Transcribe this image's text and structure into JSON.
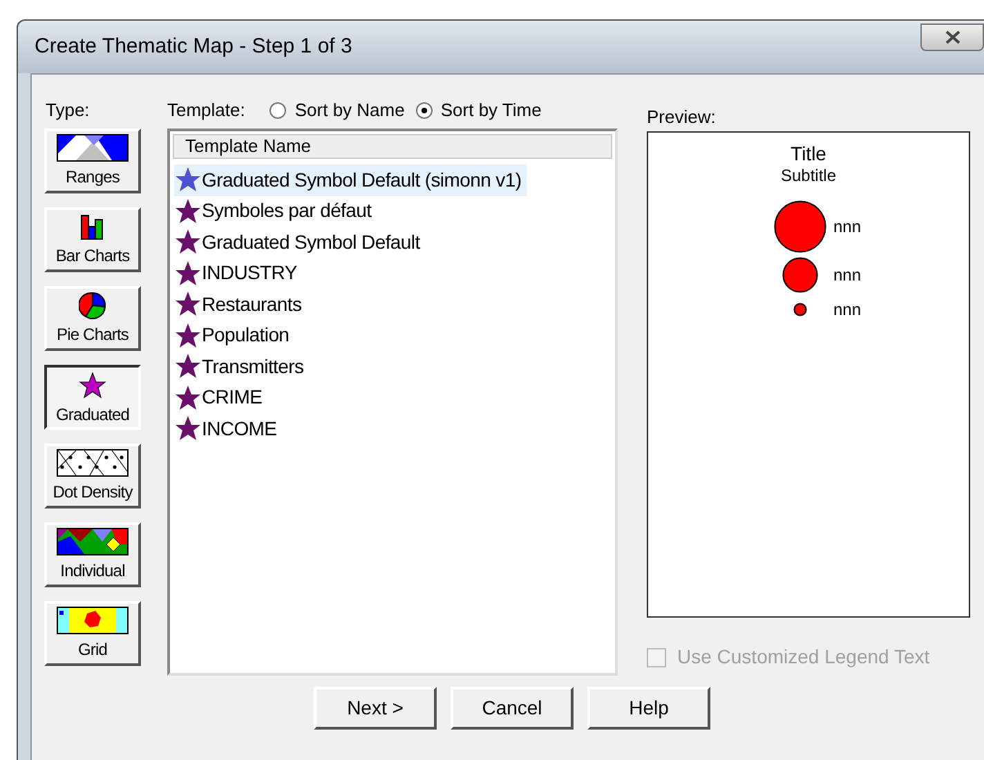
{
  "window": {
    "title": "Create Thematic Map - Step 1 of 3"
  },
  "type_panel": {
    "label": "Type:",
    "types": [
      {
        "kind": "ranges",
        "label": "Ranges",
        "selected": false
      },
      {
        "kind": "bar",
        "label": "Bar Charts",
        "selected": false
      },
      {
        "kind": "pie",
        "label": "Pie Charts",
        "selected": false
      },
      {
        "kind": "graduated",
        "label": "Graduated",
        "selected": true
      },
      {
        "kind": "dot",
        "label": "Dot Density",
        "selected": false
      },
      {
        "kind": "individual",
        "label": "Individual",
        "selected": false
      },
      {
        "kind": "grid",
        "label": "Grid",
        "selected": false
      }
    ]
  },
  "template": {
    "label": "Template:",
    "sort_options": [
      {
        "label": "Sort by Name",
        "selected": false
      },
      {
        "label": "Sort by Time",
        "selected": true
      }
    ],
    "column": "Template Name",
    "items": [
      {
        "name": "Graduated Symbol Default (simonn v1)",
        "selected": true
      },
      {
        "name": "Symboles par défaut",
        "selected": false
      },
      {
        "name": "Graduated Symbol Default",
        "selected": false
      },
      {
        "name": "INDUSTRY",
        "selected": false
      },
      {
        "name": "Restaurants",
        "selected": false
      },
      {
        "name": "Population",
        "selected": false
      },
      {
        "name": "Transmitters",
        "selected": false
      },
      {
        "name": "CRIME",
        "selected": false
      },
      {
        "name": "INCOME",
        "selected": false
      }
    ]
  },
  "preview": {
    "label": "Preview:",
    "title": "Title",
    "subtitle": "Subtitle",
    "legend": [
      {
        "label": "nnn"
      },
      {
        "label": "nnn"
      },
      {
        "label": "nnn"
      }
    ]
  },
  "legend_option": {
    "label": "Use Customized Legend Text",
    "checked": false,
    "disabled": true
  },
  "buttons": [
    "Next >",
    "Cancel",
    "Help"
  ]
}
